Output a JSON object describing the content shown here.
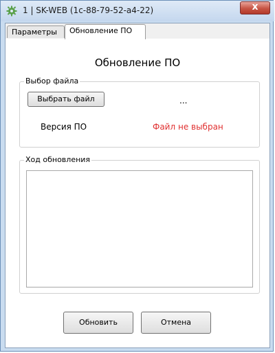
{
  "window": {
    "title": "1  |  SK-WEB (1c-88-79-52-a4-22)",
    "icon": "gear-icon",
    "close_glyph": "x",
    "accent_color": "#c75444"
  },
  "tabs": [
    {
      "label": "Параметры",
      "active": false
    },
    {
      "label": "Обновление ПО",
      "active": true
    }
  ],
  "page": {
    "heading": "Обновление ПО",
    "file_group": {
      "label": "Выбор файла",
      "choose_button": "Выбрать файл",
      "file_name": "...",
      "version_label": "Версия ПО",
      "version_value": "Файл не выбран",
      "version_value_color": "#e03030"
    },
    "progress_group": {
      "label": "Ход обновления",
      "log_text": ""
    },
    "buttons": {
      "update": "Обновить",
      "cancel": "Отмена"
    }
  }
}
